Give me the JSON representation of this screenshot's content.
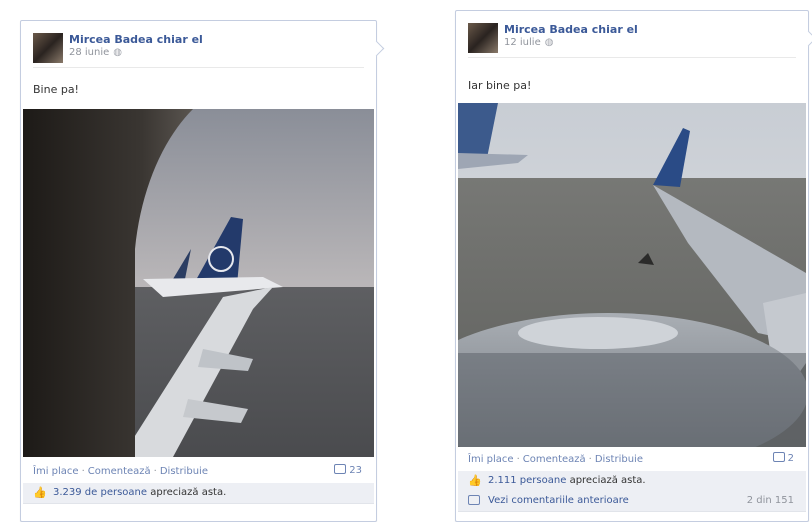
{
  "posts": [
    {
      "author": "Mircea Badea chiar el",
      "date": "28 iunie",
      "text": "Bine pa!",
      "actions": {
        "like": "Îmi place",
        "comment": "Comentează",
        "share": "Distribuie",
        "comment_count": "23"
      },
      "likes": {
        "count": "3.239 de persoane",
        "suffix": "apreciază asta."
      }
    },
    {
      "author": "Mircea Badea chiar el",
      "date": "12 iulie",
      "text": "Iar bine pa!",
      "actions": {
        "like": "Îmi place",
        "comment": "Comentează",
        "share": "Distribuie",
        "comment_count": "2"
      },
      "likes": {
        "count": "2.111 persoane",
        "suffix": "apreciază asta."
      },
      "previous_comments": {
        "label": "Vezi comentariile anterioare",
        "count": "2 din 151"
      }
    }
  ],
  "icons": {
    "privacy": "globe-icon",
    "like": "thumbs-up-icon",
    "comment": "comment-bubble-icon"
  },
  "colors": {
    "link": "#3b5998",
    "border": "#c4cde0",
    "likebar": "#edeff4"
  }
}
